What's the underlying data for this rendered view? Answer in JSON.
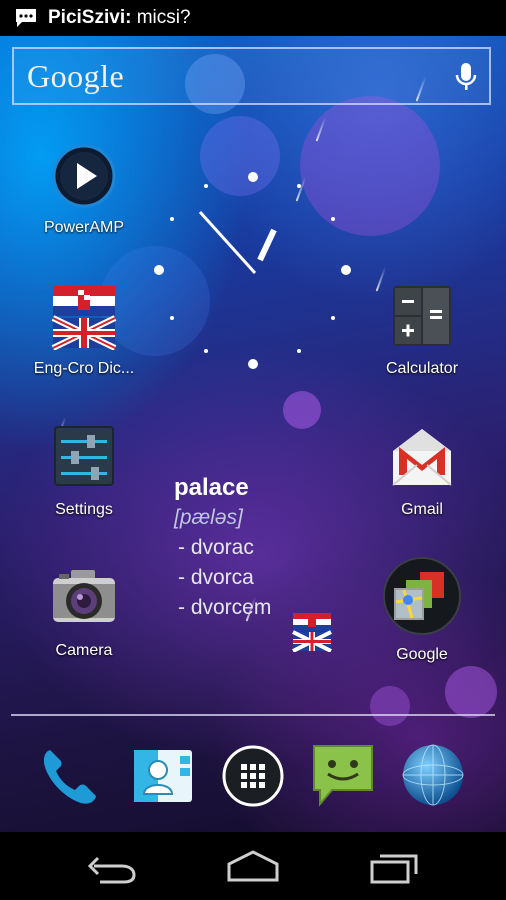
{
  "status_bar": {
    "notification_sender": "PiciSzivi:",
    "notification_message": "micsi?",
    "icon": "chat-bubble-icon"
  },
  "search_widget": {
    "logo_text": "Google",
    "mic_icon": "microphone-icon"
  },
  "home_apps": [
    {
      "label": "PowerAMP",
      "icon": "play-icon"
    },
    {
      "label": "Eng-Cro Dic...",
      "icon": "flags-icon"
    },
    {
      "label": "Calculator",
      "icon": "calculator-icon"
    },
    {
      "label": "Settings",
      "icon": "sliders-icon"
    },
    {
      "label": "Gmail",
      "icon": "gmail-envelope-icon"
    },
    {
      "label": "Camera",
      "icon": "camera-icon"
    },
    {
      "label": "Google",
      "icon": "google-folder-icon"
    }
  ],
  "clock_widget": {
    "type": "analog-clock"
  },
  "dictionary_widget": {
    "word": "palace",
    "pronunciation": "[pæləs]",
    "translations": [
      "- dvorac",
      "- dvorca",
      "- dvorcem"
    ]
  },
  "dock": [
    {
      "name": "phone",
      "icon": "phone-icon"
    },
    {
      "name": "contacts",
      "icon": "contacts-icon"
    },
    {
      "name": "all-apps",
      "icon": "app-drawer-icon"
    },
    {
      "name": "messaging",
      "icon": "messaging-icon"
    },
    {
      "name": "browser",
      "icon": "globe-icon"
    }
  ],
  "nav_bar": [
    "back-icon",
    "home-icon",
    "recent-apps-icon"
  ],
  "colors": {
    "accent": "#33b5e5",
    "wallpaper_top": "#0b5fc7",
    "wallpaper_bottom": "#140d2b"
  }
}
